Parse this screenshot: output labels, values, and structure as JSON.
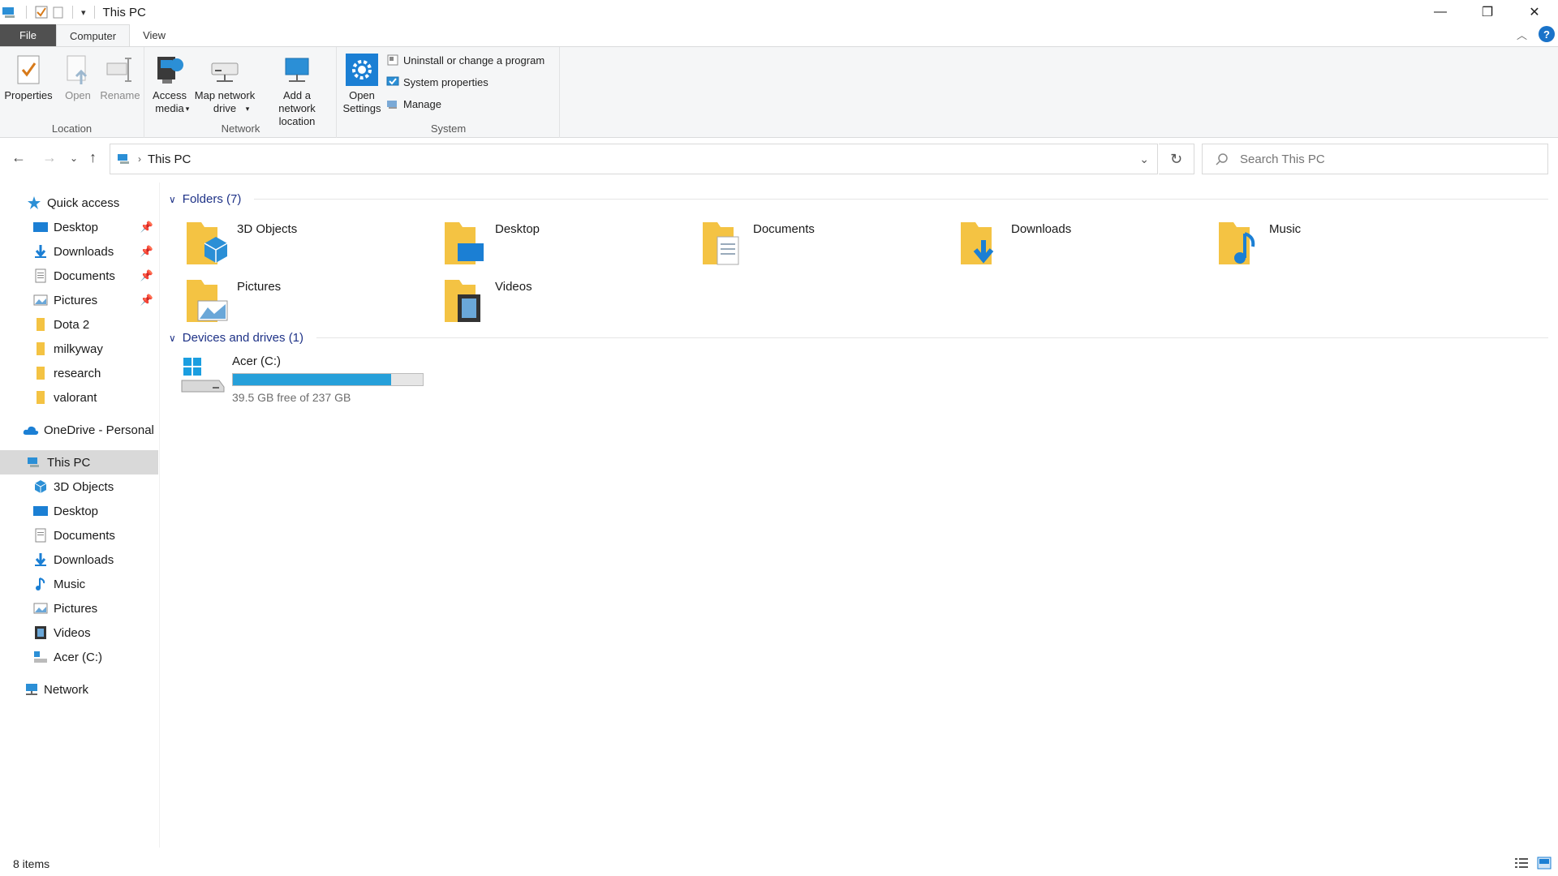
{
  "window": {
    "title": "This PC",
    "minimize": "—",
    "maximize": "❐",
    "close": "✕"
  },
  "ribbon": {
    "tabs": [
      "File",
      "Computer",
      "View"
    ],
    "location": {
      "label": "Location",
      "properties": "Properties",
      "open": "Open",
      "rename": "Rename"
    },
    "network": {
      "label": "Network",
      "access_media": "Access media",
      "map_network_drive": "Map network drive",
      "add_network_location": "Add a network location"
    },
    "system": {
      "label": "System",
      "open_settings": "Open Settings",
      "uninstall": "Uninstall or change a program",
      "system_properties": "System properties",
      "manage": "Manage"
    },
    "help": "?"
  },
  "address": {
    "path": "This PC",
    "search_placeholder": "Search This PC"
  },
  "nav": {
    "quick_access": "Quick access",
    "quick_items": [
      "Desktop",
      "Downloads",
      "Documents",
      "Pictures",
      "Dota 2",
      "milkyway",
      "research",
      "valorant"
    ],
    "onedrive": "OneDrive - Personal",
    "this_pc": "This PC",
    "pc_items": [
      "3D Objects",
      "Desktop",
      "Documents",
      "Downloads",
      "Music",
      "Pictures",
      "Videos",
      "Acer (C:)"
    ],
    "network": "Network"
  },
  "content": {
    "folders_header": "Folders (7)",
    "folders": [
      "3D Objects",
      "Desktop",
      "Documents",
      "Downloads",
      "Music",
      "Pictures",
      "Videos"
    ],
    "devices_header": "Devices and drives (1)",
    "drive": {
      "name": "Acer (C:)",
      "free_text": "39.5 GB free of 237 GB",
      "used_fraction": 0.833
    }
  },
  "status": {
    "items": "8 items"
  },
  "colors": {
    "accent": "#1e3287",
    "drive_fill": "#26a0da",
    "folder": "#f4c343"
  }
}
